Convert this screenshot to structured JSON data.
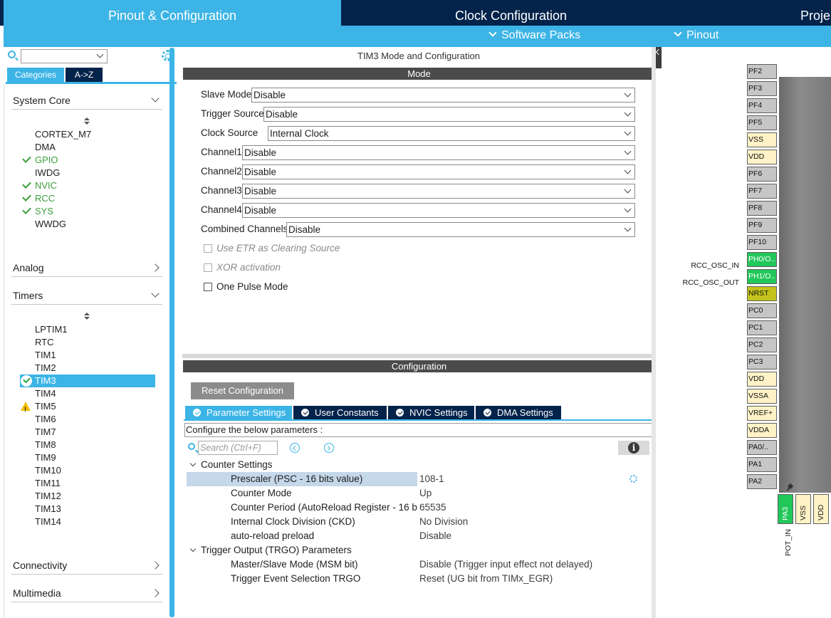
{
  "top_tabs": {
    "pinout": "Pinout & Configuration",
    "clock": "Clock Configuration",
    "project": "Proje"
  },
  "sub_bar": {
    "software_packs": "Software Packs",
    "pinout": "Pinout"
  },
  "left": {
    "cat_tabs": {
      "categories": "Categories",
      "az": "A->Z"
    },
    "sections": {
      "system_core": "System Core",
      "analog": "Analog",
      "timers": "Timers",
      "connectivity": "Connectivity",
      "multimedia": "Multimedia"
    },
    "system_core_items": [
      "CORTEX_M7",
      "DMA",
      "GPIO",
      "IWDG",
      "NVIC",
      "RCC",
      "SYS",
      "WWDG"
    ],
    "timer_items": [
      "LPTIM1",
      "RTC",
      "TIM1",
      "TIM2",
      "TIM3",
      "TIM4",
      "TIM5",
      "TIM6",
      "TIM7",
      "TIM8",
      "TIM9",
      "TIM10",
      "TIM11",
      "TIM12",
      "TIM13",
      "TIM14"
    ]
  },
  "mid": {
    "title": "TIM3 Mode and Configuration",
    "mode_bar": "Mode",
    "mode_rows": {
      "slave": {
        "label": "Slave Mode",
        "value": "Disable"
      },
      "trigger": {
        "label": "Trigger Source",
        "value": "Disable"
      },
      "clock": {
        "label": "Clock Source",
        "value": "Internal Clock"
      },
      "ch1": {
        "label": "Channel1",
        "value": "Disable"
      },
      "ch2": {
        "label": "Channel2",
        "value": "Disable"
      },
      "ch3": {
        "label": "Channel3",
        "value": "Disable"
      },
      "ch4": {
        "label": "Channel4",
        "value": "Disable"
      },
      "combined": {
        "label": "Combined Channels",
        "value": "Disable"
      }
    },
    "checkboxes": {
      "etr": "Use ETR as Clearing Source",
      "xor": "XOR activation",
      "one_pulse": "One Pulse Mode"
    },
    "config_bar": "Configuration",
    "reset_button": "Reset Configuration",
    "tabs": {
      "params": "Parameter Settings",
      "user_constants": "User Constants",
      "nvic": "NVIC Settings",
      "dma": "DMA Settings"
    },
    "hint": "Configure the below parameters :",
    "search_placeholder": "Search (Ctrl+F)",
    "groups": {
      "counter": "Counter Settings",
      "trgo": "Trigger Output (TRGO) Parameters"
    },
    "params": {
      "prescaler": {
        "name": "Prescaler (PSC - 16 bits value)",
        "value": "108-1"
      },
      "counter_mode": {
        "name": "Counter Mode",
        "value": "Up"
      },
      "period": {
        "name": "Counter Period (AutoReload Register - 16 b...",
        "value": "65535"
      },
      "ckd": {
        "name": "Internal Clock Division (CKD)",
        "value": "No Division"
      },
      "preload": {
        "name": "auto-reload preload",
        "value": "Disable"
      },
      "msm": {
        "name": "Master/Slave Mode (MSM bit)",
        "value": "Disable (Trigger input effect not delayed)"
      },
      "trgo_sel": {
        "name": "Trigger Event Selection TRGO",
        "value": "Reset (UG bit from TIMx_EGR)"
      }
    }
  },
  "pinout": {
    "pins": [
      "PF2",
      "PF3",
      "PF4",
      "PF5",
      "VSS",
      "VDD",
      "PF6",
      "PF7",
      "PF8",
      "PF9",
      "PF10",
      "PH0/O..",
      "PH1/O..",
      "NRST",
      "PC0",
      "PC1",
      "PC2",
      "PC3",
      "VDD",
      "VSSA",
      "VREF+",
      "VDDA",
      "PA0/..",
      "PA1",
      "PA2"
    ],
    "signals": {
      "osc_in": "RCC_OSC_IN",
      "osc_out": "RCC_OSC_OUT"
    },
    "bottom_pins": [
      "PA3",
      "VSS",
      "VDD"
    ],
    "pot_label": "POT_IN"
  },
  "colors": {
    "accent": "#3cb4e6",
    "navy": "#03234b",
    "pin_green": "#22c75a",
    "pin_power": "#fff2c6",
    "ok_green": "#3a9e3a",
    "warn_yellow": "#f0c000"
  }
}
